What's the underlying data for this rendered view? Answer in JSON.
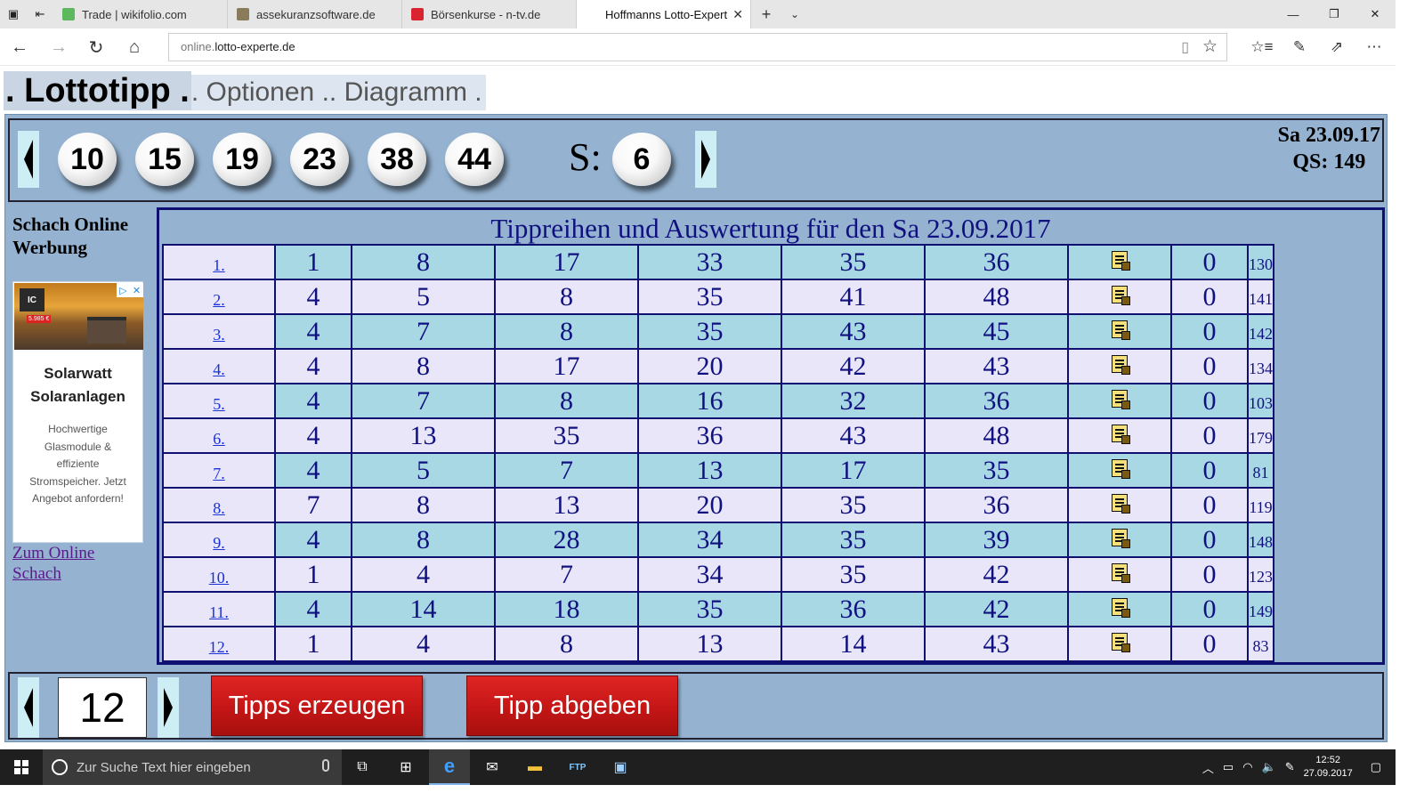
{
  "browser": {
    "tabs": [
      {
        "label": "Trade | wikifolio.com",
        "color": "#5cb85c"
      },
      {
        "label": "assekuranzsoftware.de",
        "color": "#8a7b5a"
      },
      {
        "label": "Börsenkurse - n-tv.de",
        "color": "#d9232e"
      },
      {
        "label": "Hoffmanns Lotto-Expert",
        "color": "#ffffff"
      }
    ],
    "url_prefix": "online.",
    "url_domain": "lotto-experte.de"
  },
  "header": {
    "current": ". Lottotipp .",
    "rest": ". Optionen .. Diagramm ."
  },
  "draw": {
    "numbers": [
      "10",
      "15",
      "19",
      "23",
      "38",
      "44"
    ],
    "super_label": "S:",
    "super_number": "6",
    "date": "Sa 23.09.17",
    "qs": "QS: 149"
  },
  "sidebar": {
    "title": "Schach Online Werbung",
    "ad_logo": "IC",
    "ad_price": "5.985 €",
    "ad_title": "Solarwatt Solaranlagen",
    "ad_text": "Hochwertige Glasmodule & effiziente Stromspeicher. Jetzt Angebot anfordern!",
    "link": "Zum Online Schach"
  },
  "tips": {
    "title": "Tippreihen und Auswertung für den Sa 23.09.2017",
    "rows": [
      {
        "idx": "1.",
        "n": [
          "1",
          "8",
          "17",
          "33",
          "35",
          "36"
        ],
        "hits": "0",
        "qs": "130"
      },
      {
        "idx": "2.",
        "n": [
          "4",
          "5",
          "8",
          "35",
          "41",
          "48"
        ],
        "hits": "0",
        "qs": "141"
      },
      {
        "idx": "3.",
        "n": [
          "4",
          "7",
          "8",
          "35",
          "43",
          "45"
        ],
        "hits": "0",
        "qs": "142"
      },
      {
        "idx": "4.",
        "n": [
          "4",
          "8",
          "17",
          "20",
          "42",
          "43"
        ],
        "hits": "0",
        "qs": "134"
      },
      {
        "idx": "5.",
        "n": [
          "4",
          "7",
          "8",
          "16",
          "32",
          "36"
        ],
        "hits": "0",
        "qs": "103"
      },
      {
        "idx": "6.",
        "n": [
          "4",
          "13",
          "35",
          "36",
          "43",
          "48"
        ],
        "hits": "0",
        "qs": "179"
      },
      {
        "idx": "7.",
        "n": [
          "4",
          "5",
          "7",
          "13",
          "17",
          "35"
        ],
        "hits": "0",
        "qs": "81"
      },
      {
        "idx": "8.",
        "n": [
          "7",
          "8",
          "13",
          "20",
          "35",
          "36"
        ],
        "hits": "0",
        "qs": "119"
      },
      {
        "idx": "9.",
        "n": [
          "4",
          "8",
          "28",
          "34",
          "35",
          "39"
        ],
        "hits": "0",
        "qs": "148"
      },
      {
        "idx": "10.",
        "n": [
          "1",
          "4",
          "7",
          "34",
          "35",
          "42"
        ],
        "hits": "0",
        "qs": "123"
      },
      {
        "idx": "11.",
        "n": [
          "4",
          "14",
          "18",
          "35",
          "36",
          "42"
        ],
        "hits": "0",
        "qs": "149"
      },
      {
        "idx": "12.",
        "n": [
          "1",
          "4",
          "8",
          "13",
          "14",
          "43"
        ],
        "hits": "0",
        "qs": "83"
      }
    ]
  },
  "controls": {
    "count": "12",
    "generate_label": "Tipps erzeugen",
    "submit_label": "Tipp abgeben"
  },
  "taskbar": {
    "search_placeholder": "Zur Suche Text hier eingeben",
    "time": "12:52",
    "date": "27.09.2017",
    "ftp_label": "FTP"
  }
}
